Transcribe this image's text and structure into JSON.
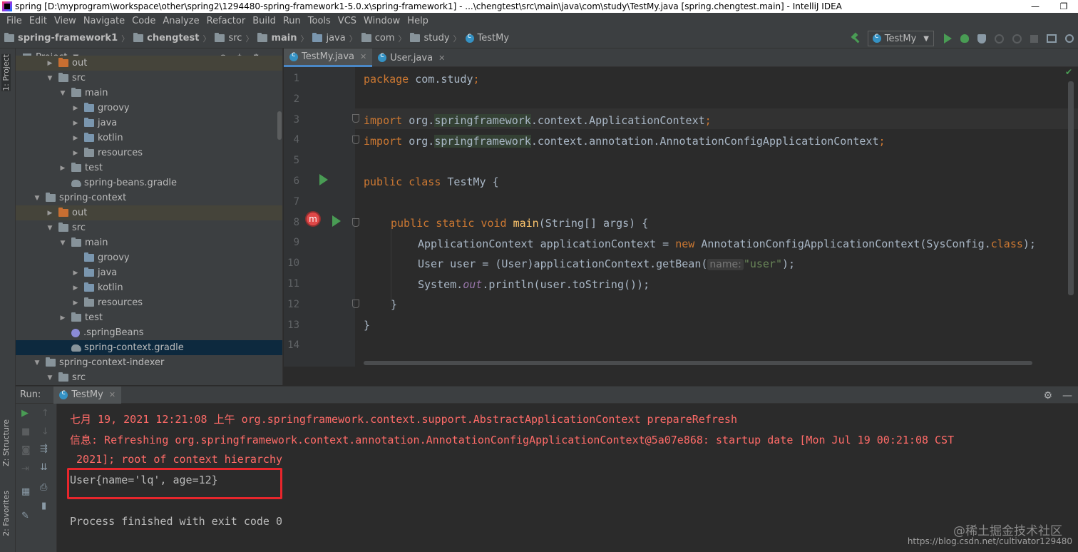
{
  "window": {
    "title": "spring [D:\\myprogram\\workspace\\other\\spring2\\1294480-spring-framework1-5.0.x\\spring-framework1] - ...\\chengtest\\src\\main\\java\\com\\study\\TestMy.java [spring.chengtest.main] - IntelliJ IDEA",
    "minimize": "—",
    "restore": "❐"
  },
  "menu": [
    "File",
    "Edit",
    "View",
    "Navigate",
    "Code",
    "Analyze",
    "Refactor",
    "Build",
    "Run",
    "Tools",
    "VCS",
    "Window",
    "Help"
  ],
  "breadcrumbs": [
    "spring-framework1",
    "chengtest",
    "src",
    "main",
    "java",
    "com",
    "study",
    "TestMy"
  ],
  "run_config": {
    "selected": "TestMy"
  },
  "left_strip": {
    "project_tab": "1: Project",
    "structure_tab": "Z: Structure",
    "favorites_tab": "2: Favorites"
  },
  "project_panel": {
    "title": "Project",
    "tree": [
      {
        "label": "out",
        "depth": 2,
        "arrow": "▶",
        "icon": "folder-orange",
        "excluded": true
      },
      {
        "label": "src",
        "depth": 2,
        "arrow": "▼",
        "icon": "folder"
      },
      {
        "label": "main",
        "depth": 3,
        "arrow": "▼",
        "icon": "folder"
      },
      {
        "label": "groovy",
        "depth": 4,
        "arrow": "▶",
        "icon": "folder-src"
      },
      {
        "label": "java",
        "depth": 4,
        "arrow": "▶",
        "icon": "folder-src"
      },
      {
        "label": "kotlin",
        "depth": 4,
        "arrow": "▶",
        "icon": "folder-src"
      },
      {
        "label": "resources",
        "depth": 4,
        "arrow": "▶",
        "icon": "folder-res"
      },
      {
        "label": "test",
        "depth": 3,
        "arrow": "▶",
        "icon": "folder"
      },
      {
        "label": "spring-beans.gradle",
        "depth": 3,
        "arrow": "",
        "icon": "gradle"
      },
      {
        "label": "spring-context",
        "depth": 1,
        "arrow": "▼",
        "icon": "folder"
      },
      {
        "label": "out",
        "depth": 2,
        "arrow": "▶",
        "icon": "folder-orange",
        "excluded": true
      },
      {
        "label": "src",
        "depth": 2,
        "arrow": "▼",
        "icon": "folder"
      },
      {
        "label": "main",
        "depth": 3,
        "arrow": "▼",
        "icon": "folder"
      },
      {
        "label": "groovy",
        "depth": 4,
        "arrow": "",
        "icon": "folder-src"
      },
      {
        "label": "java",
        "depth": 4,
        "arrow": "▶",
        "icon": "folder-src"
      },
      {
        "label": "kotlin",
        "depth": 4,
        "arrow": "▶",
        "icon": "folder-src"
      },
      {
        "label": "resources",
        "depth": 4,
        "arrow": "▶",
        "icon": "folder-res"
      },
      {
        "label": "test",
        "depth": 3,
        "arrow": "▶",
        "icon": "folder"
      },
      {
        "label": ".springBeans",
        "depth": 3,
        "arrow": "",
        "icon": "spring"
      },
      {
        "label": "spring-context.gradle",
        "depth": 3,
        "arrow": "",
        "icon": "gradle",
        "selected": true
      },
      {
        "label": "spring-context-indexer",
        "depth": 1,
        "arrow": "▼",
        "icon": "folder"
      },
      {
        "label": "src",
        "depth": 2,
        "arrow": "▼",
        "icon": "folder"
      }
    ]
  },
  "editor": {
    "tabs": [
      {
        "label": "TestMy.java",
        "active": true
      },
      {
        "label": "User.java",
        "active": false
      }
    ],
    "line_numbers": [
      "1",
      "2",
      "3",
      "4",
      "5",
      "6",
      "7",
      "8",
      "9",
      "10",
      "11",
      "12",
      "13",
      "14"
    ],
    "code": {
      "l1_kw": "package",
      "l1_rest": " com.study",
      "l3_kw": "import",
      "l3_a": " org.",
      "l3_hl": "springframework",
      "l3_b": ".context.ApplicationContext",
      "l4_kw": "import",
      "l4_a": " org.",
      "l4_hl": "springframework",
      "l4_b": ".context.annotation.AnnotationConfigApplicationContext",
      "l6_kw": "public class",
      "l6_rest": " TestMy {",
      "l8_kw": "public static void",
      "l8_fn": "main",
      "l8_rest": "(String[] args) {",
      "l9_a": "ApplicationContext applicationContext = ",
      "l9_kw": "new",
      "l9_b": " AnnotationConfigApplicationContext(SysConfig.",
      "l9_kw2": "class",
      "l9_c": ");",
      "l10_a": "User user = (User)applicationContext.getBean(",
      "l10_hint": "name:",
      "l10_str": "\"user\"",
      "l10_b": ");",
      "l11_a": "System.",
      "l11_static": "out",
      "l11_b": ".println(user.toString());",
      "l12": "}",
      "l13": "}",
      "semicolon": ";"
    }
  },
  "run_panel": {
    "label": "Run:",
    "tab": "TestMy",
    "console": [
      {
        "text": "七月 19, 2021 12:21:08 上午 org.springframework.context.support.AbstractApplicationContext prepareRefresh",
        "style": "red"
      },
      {
        "text": "信息: Refreshing org.springframework.context.annotation.AnnotationConfigApplicationContext@5a07e868: startup date [Mon Jul 19 00:21:08 CST",
        "style": "red"
      },
      {
        "text": " 2021]; root of context hierarchy",
        "style": "red"
      },
      {
        "text": "User{name='lq', age=12}",
        "style": "normal"
      },
      {
        "text": "Process finished with exit code 0",
        "style": "normal"
      }
    ]
  },
  "watermark": {
    "text": "@稀土掘金技术社区",
    "url": "https://blog.csdn.net/cultivator129480"
  },
  "colors": {
    "keyword": "#cc7832",
    "string": "#6a8759",
    "function": "#ffc66d",
    "console_error": "#ff6b68",
    "highlight_box": "#e8262c"
  }
}
